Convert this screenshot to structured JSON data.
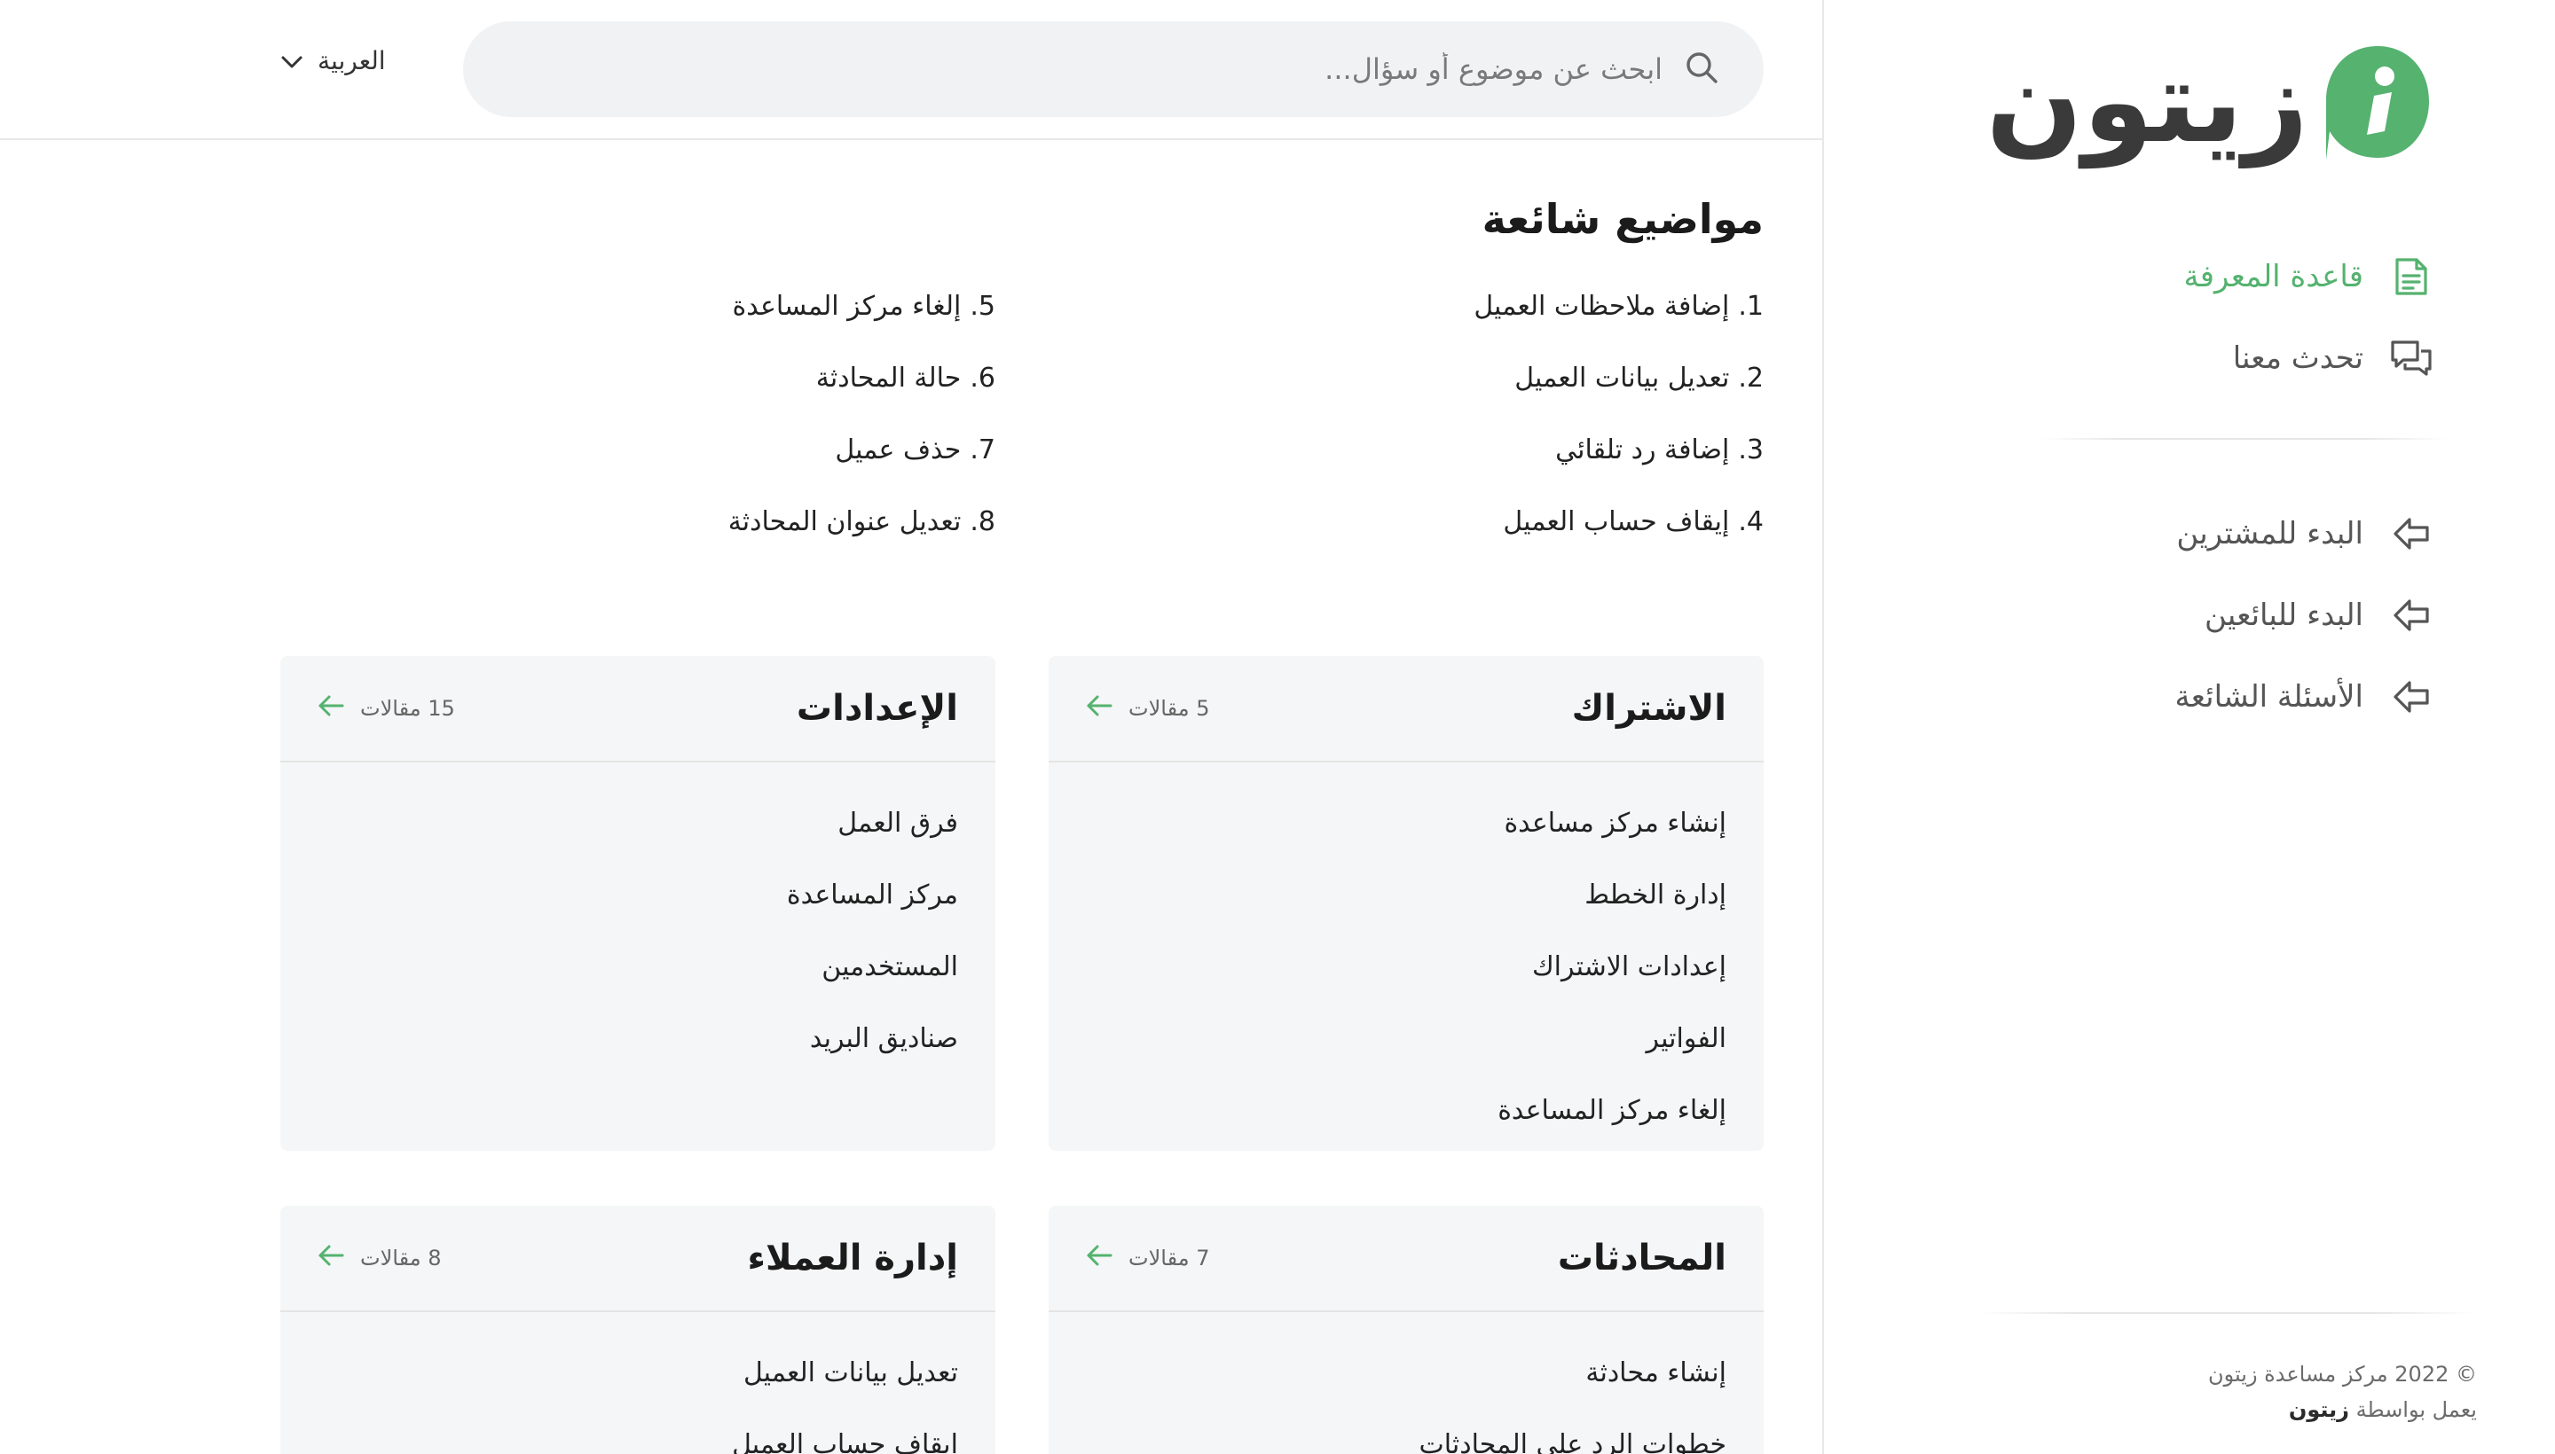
{
  "brand": {
    "name": "زيتون",
    "accent_color": "#55b26f"
  },
  "sidebar": {
    "primary": [
      {
        "label": "قاعدة المعرفة",
        "icon": "document-icon",
        "active": true
      },
      {
        "label": "تحدث معنا",
        "icon": "chat-bubbles-icon",
        "active": false
      }
    ],
    "secondary": [
      {
        "label": "البدء للمشترين",
        "icon": "arrow-left-outline-icon"
      },
      {
        "label": "البدء للبائعين",
        "icon": "arrow-left-outline-icon"
      },
      {
        "label": "الأسئلة الشائعة",
        "icon": "arrow-left-outline-icon"
      }
    ],
    "footer": {
      "copyright": "© 2022 مركز مساعدة زيتون",
      "powered_prefix": "يعمل بواسطة",
      "powered_brand": "زيتون"
    }
  },
  "header": {
    "search_placeholder": "ابحث عن موضوع أو سؤال...",
    "language": "العربية"
  },
  "popular": {
    "title": "مواضيع شائعة",
    "items": [
      {
        "num": "1.",
        "label": "إضافة ملاحظات العميل"
      },
      {
        "num": "2.",
        "label": "تعديل بيانات العميل"
      },
      {
        "num": "3.",
        "label": "إضافة رد تلقائي"
      },
      {
        "num": "4.",
        "label": "إيقاف حساب العميل"
      },
      {
        "num": "5.",
        "label": "إلغاء مركز المساعدة"
      },
      {
        "num": "6.",
        "label": "حالة المحادثة"
      },
      {
        "num": "7.",
        "label": "حذف عميل"
      },
      {
        "num": "8.",
        "label": "تعديل عنوان المحادثة"
      }
    ]
  },
  "categories": [
    {
      "title": "الاشتراك",
      "count": "5 مقالات",
      "links": [
        "إنشاء مركز مساعدة",
        "إدارة الخطط",
        "إعدادات الاشتراك",
        "الفواتير",
        "إلغاء مركز المساعدة"
      ]
    },
    {
      "title": "الإعدادات",
      "count": "15 مقالات",
      "links": [
        "فرق العمل",
        "مركز المساعدة",
        "المستخدمين",
        "صناديق البريد"
      ]
    },
    {
      "title": "المحادثات",
      "count": "7 مقالات",
      "links": [
        "إنشاء محادثة",
        "خطوات الرد على المحادثات"
      ]
    },
    {
      "title": "إدارة العملاء",
      "count": "8 مقالات",
      "links": [
        "تعديل بيانات العميل",
        "إيقاف حساب العميل"
      ]
    }
  ]
}
